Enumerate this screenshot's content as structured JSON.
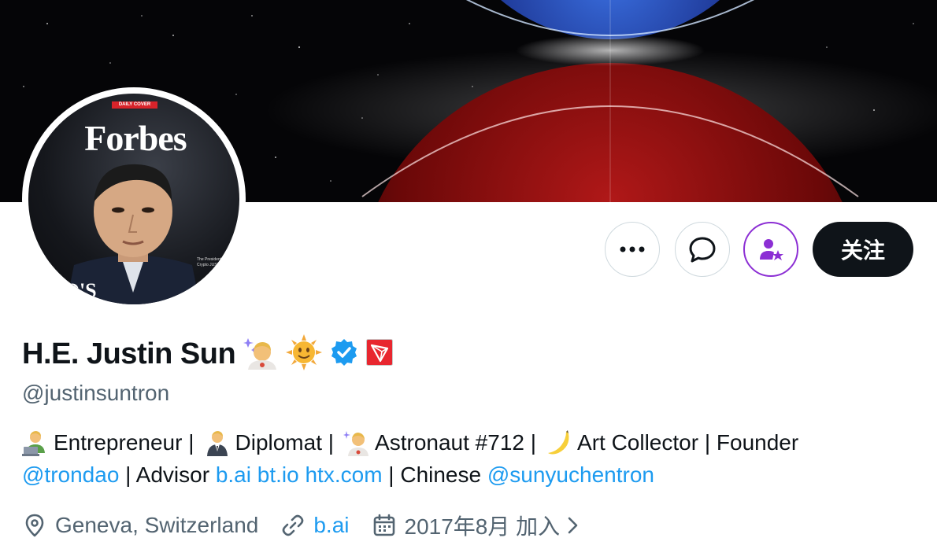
{
  "header": {
    "avatar_badge": "DAILY COVER",
    "avatar_magazine": "Forbes",
    "avatar_side_text": "The President $8.5 Bil Crypto JUSTIN",
    "avatar_bottom_text": "RTO'S"
  },
  "actions": {
    "more_icon": "more-horizontal-icon",
    "message_icon": "message-bubble-icon",
    "subscribe_icon": "subscribe-person-star-icon",
    "follow_label": "关注",
    "accent_color": "#8c2fd4"
  },
  "profile": {
    "display_name": "H.E. Justin Sun",
    "handle": "@justinsuntron",
    "name_icons": [
      "astronaut-icon",
      "sun-face-icon",
      "verified-badge-icon",
      "tron-logo-icon"
    ],
    "verified_color": "#1d9bf0"
  },
  "bio": {
    "line1": {
      "t1": "Entrepreneur |",
      "t2": "Diplomat |",
      "t3": "Astronaut #712 |",
      "t4": "Art Collector | Founder"
    },
    "line2": {
      "m1": "@trondao",
      "t1": " | Advisor ",
      "l1": "b.ai",
      "l2": "bt.io",
      "l3": "htx.com",
      "t2": " | Chinese ",
      "m2": "@sunyuchentron"
    }
  },
  "meta": {
    "location": "Geneva, Switzerland",
    "website": "b.ai",
    "joined": "2017年8月 加入"
  }
}
